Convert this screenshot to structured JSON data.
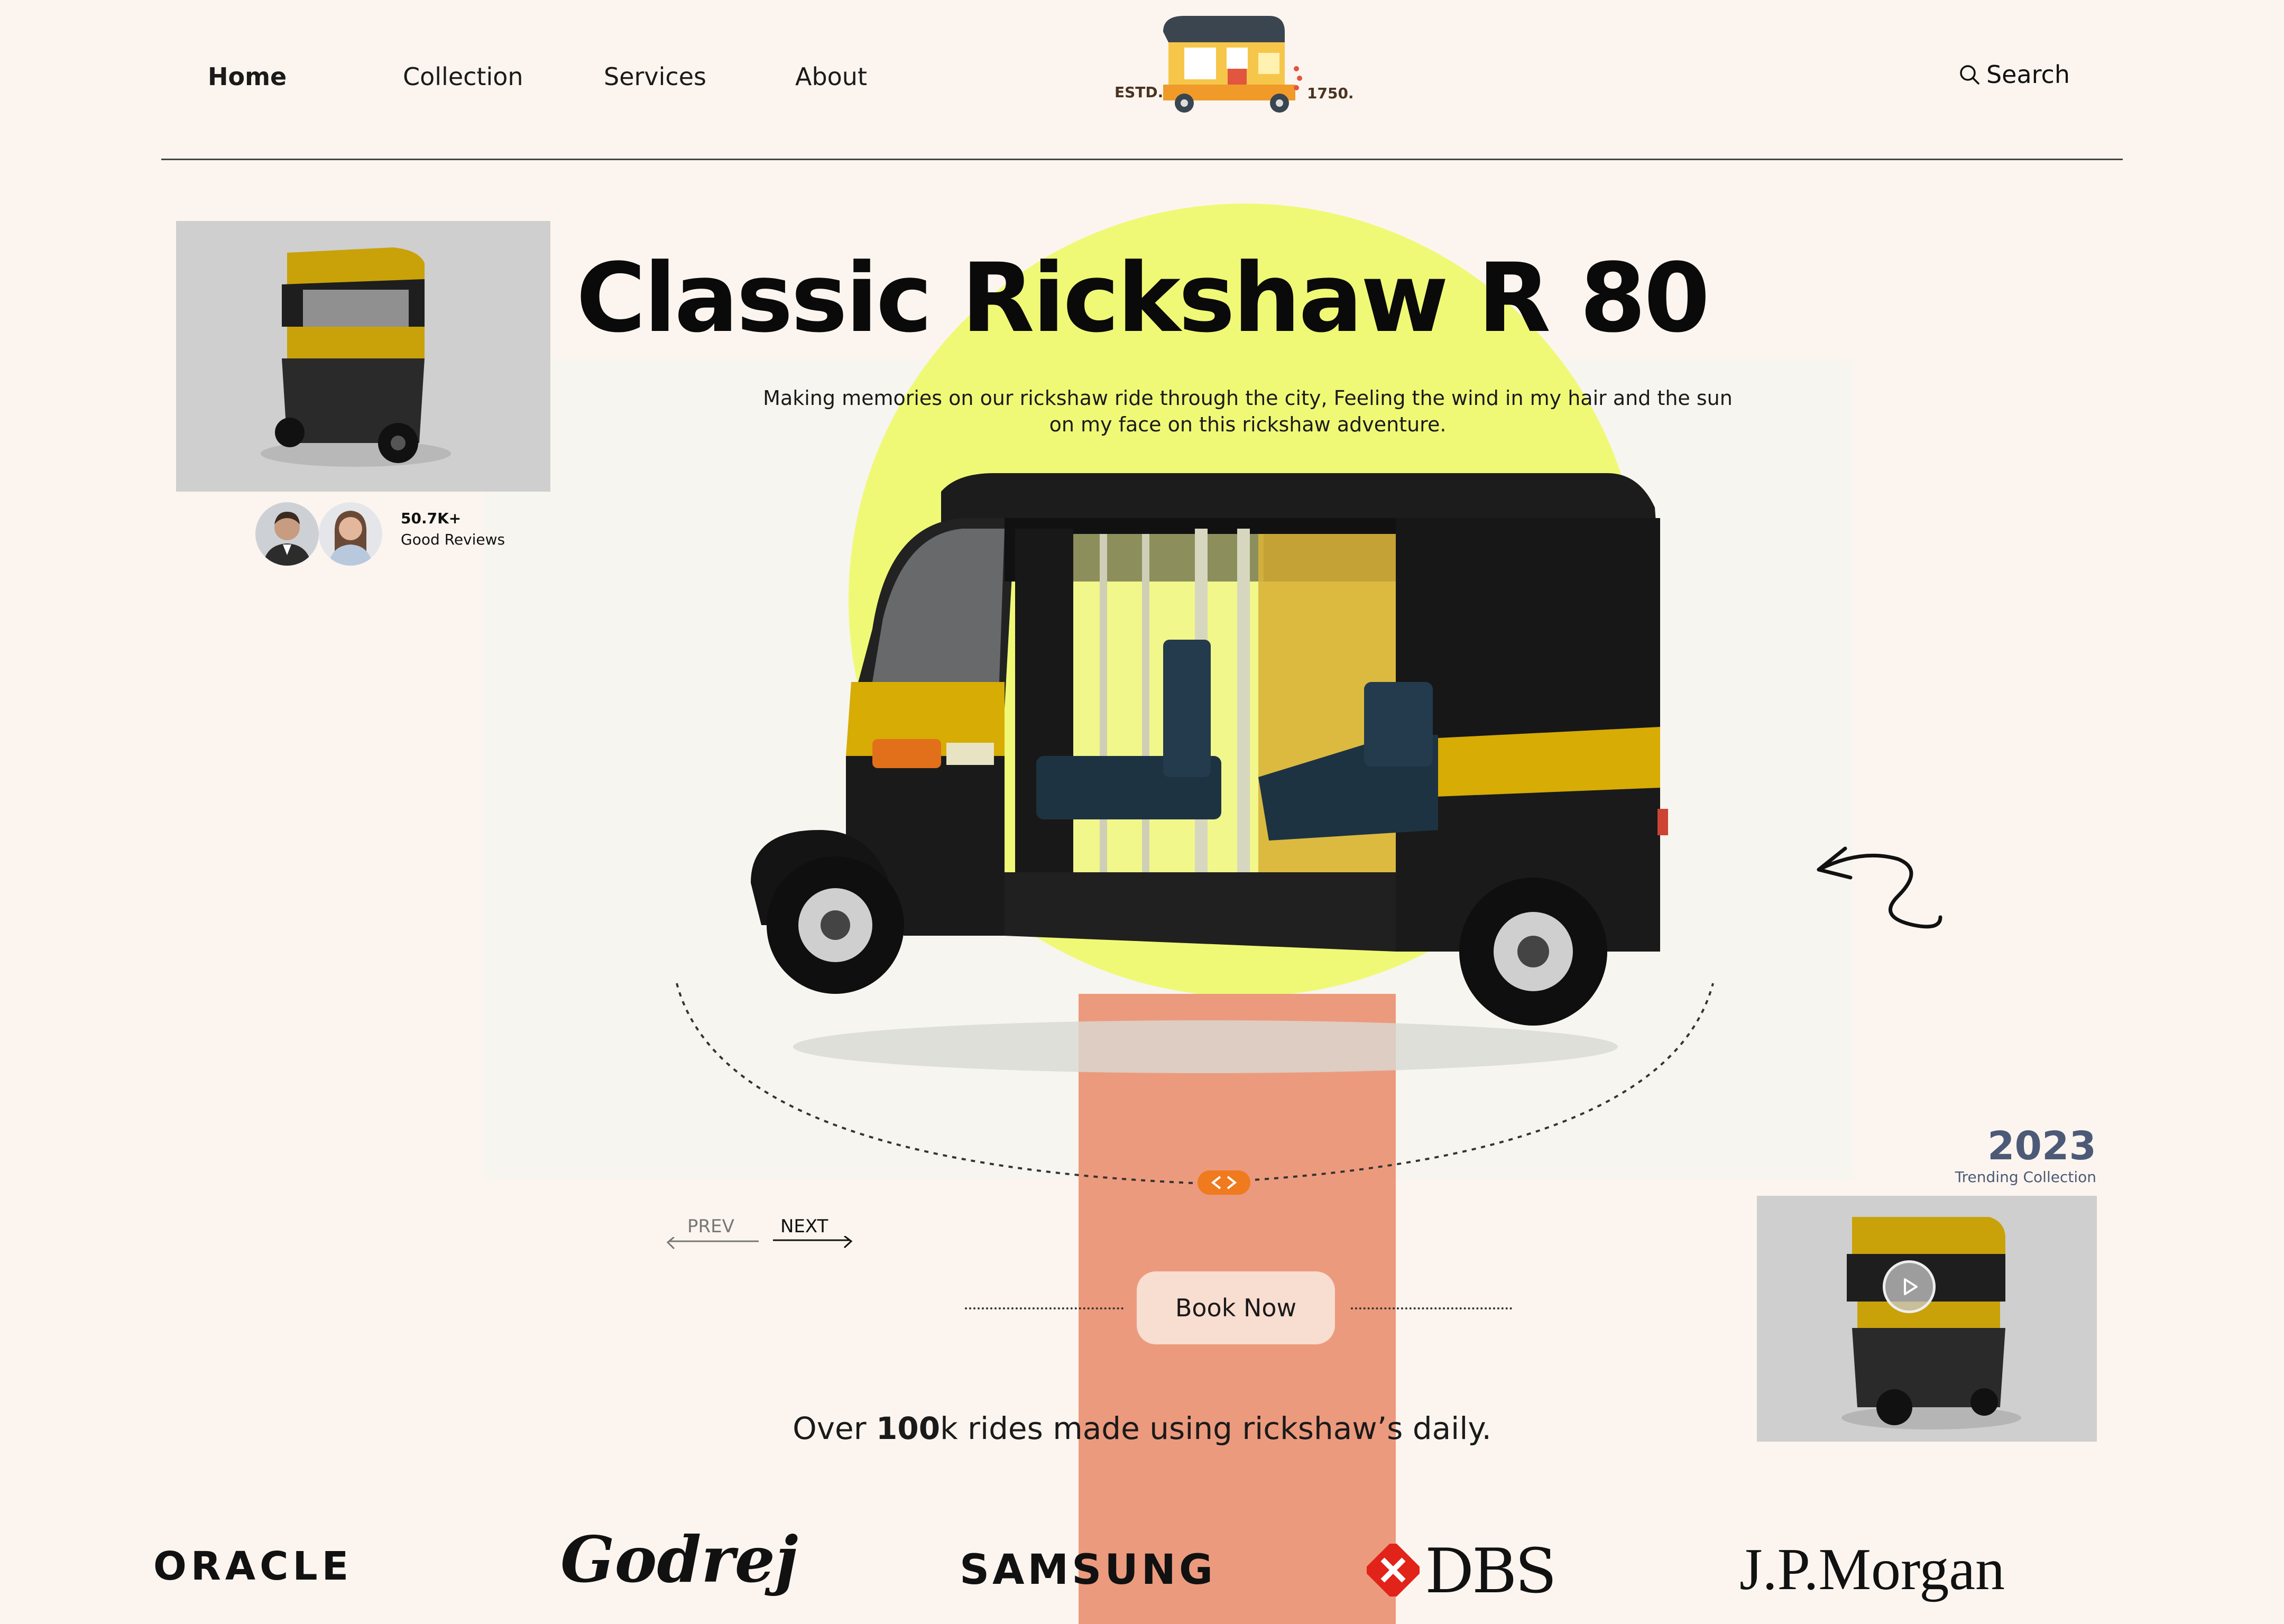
{
  "nav": {
    "items": [
      {
        "label": "Home",
        "active": true
      },
      {
        "label": "Collection",
        "active": false
      },
      {
        "label": "Services",
        "active": false
      },
      {
        "label": "About",
        "active": false
      }
    ],
    "search_label": "Search"
  },
  "logo": {
    "left_text": "ESTD.",
    "right_text": "1750."
  },
  "hero": {
    "title": "Classic Rickshaw R 80",
    "subtitle": "Making memories on our rickshaw ride through the city, Feeling the wind in my hair and the sun on my face on this rickshaw adventure."
  },
  "reviews": {
    "count": "50.7K+",
    "label": "Good Reviews"
  },
  "pager": {
    "prev": "PREV",
    "next": "NEXT"
  },
  "cta": {
    "book_label": "Book Now"
  },
  "stat": {
    "prefix": "Over ",
    "bold": "100",
    "suffix": "k rides made using rickshaw’s daily."
  },
  "trending": {
    "year": "2023",
    "label": "Trending Collection"
  },
  "brands": [
    "ORACLE",
    "Godrej",
    "SAMSUNG",
    "DBS",
    "J.P.Morgan"
  ],
  "colors": {
    "background": "#fcf5ef",
    "sun": "#eff976",
    "accent_band": "#ec9a7d",
    "button": "#f8ddd1",
    "orange_handle": "#f07a1e",
    "rickshaw_yellow": "#d8b000",
    "year_text": "#4c5a77"
  }
}
